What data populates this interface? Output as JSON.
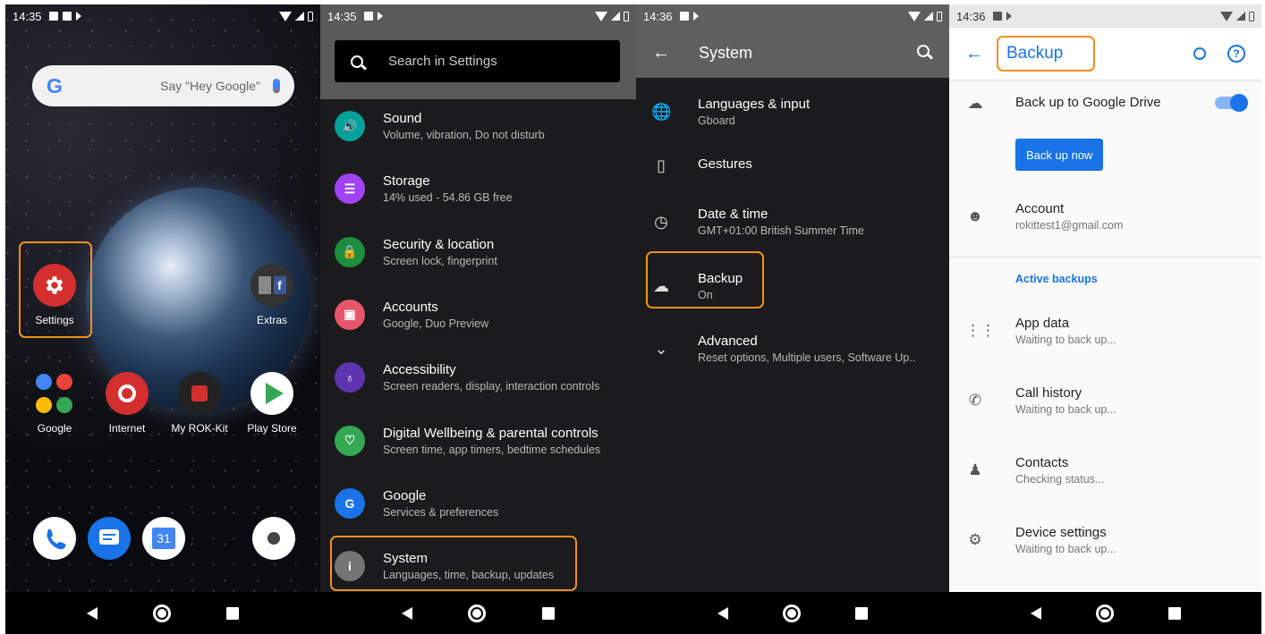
{
  "status": {
    "p1_time": "14:35",
    "p2_time": "14:35",
    "p3_time": "14:36",
    "p4_time": "14:36"
  },
  "home": {
    "search_brand": "G",
    "search_hint": "Say \"Hey Google\"",
    "apps": [
      {
        "label": "Settings"
      },
      {
        "label": "Extras"
      },
      {
        "label": "Google"
      },
      {
        "label": "Internet"
      },
      {
        "label": "My ROK-Kit"
      },
      {
        "label": "Play Store"
      }
    ],
    "calendar_day": "31"
  },
  "settings": {
    "search_placeholder": "Search in Settings",
    "items": [
      {
        "title": "Sound",
        "subtitle": "Volume, vibration, Do not disturb",
        "color": "#00a19a"
      },
      {
        "title": "Storage",
        "subtitle": "14% used - 54.86 GB free",
        "color": "#a142f4"
      },
      {
        "title": "Security & location",
        "subtitle": "Screen lock, fingerprint",
        "color": "#1e8e3e"
      },
      {
        "title": "Accounts",
        "subtitle": "Google, Duo Preview",
        "color": "#e8566c"
      },
      {
        "title": "Accessibility",
        "subtitle": "Screen readers, display, interaction controls",
        "color": "#5e35b1"
      },
      {
        "title": "Digital Wellbeing & parental controls",
        "subtitle": "Screen time, app timers, bedtime schedules",
        "color": "#34a853"
      },
      {
        "title": "Google",
        "subtitle": "Services & preferences",
        "color": "#1a73e8"
      },
      {
        "title": "System",
        "subtitle": "Languages, time, backup, updates",
        "color": "#757575"
      }
    ]
  },
  "system": {
    "title": "System",
    "items": [
      {
        "title": "Languages & input",
        "subtitle": "Gboard"
      },
      {
        "title": "Gestures",
        "subtitle": ""
      },
      {
        "title": "Date & time",
        "subtitle": "GMT+01:00 British Summer Time"
      },
      {
        "title": "Backup",
        "subtitle": "On"
      },
      {
        "title": "Advanced",
        "subtitle": "Reset options, Multiple users, Software Up.."
      }
    ]
  },
  "backup": {
    "title": "Backup",
    "drive_label": "Back up to Google Drive",
    "drive_on": true,
    "backup_now": "Back up now",
    "account_title": "Account",
    "account_email": "rokittest1@gmail.com",
    "section": "Active backups",
    "items": [
      {
        "title": "App data",
        "subtitle": "Waiting to back up..."
      },
      {
        "title": "Call history",
        "subtitle": "Waiting to back up..."
      },
      {
        "title": "Contacts",
        "subtitle": "Checking status..."
      },
      {
        "title": "Device settings",
        "subtitle": "Waiting to back up..."
      }
    ]
  },
  "accent": "#1a73e8",
  "highlight": "#f0901e"
}
